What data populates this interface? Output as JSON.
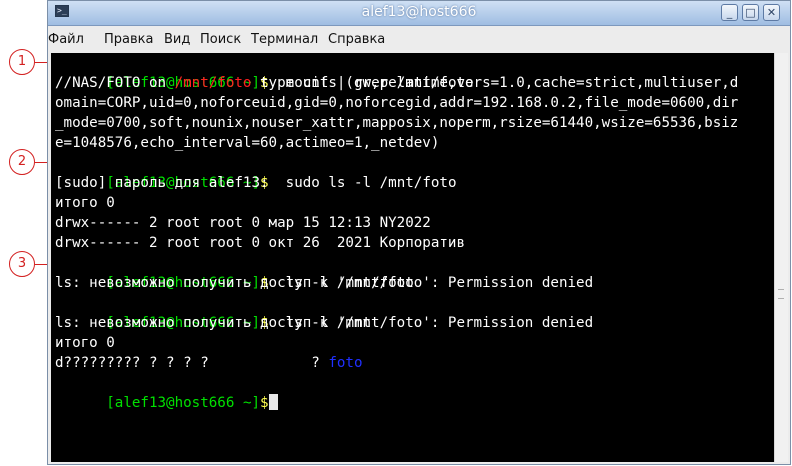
{
  "window": {
    "title": "alef13@host666",
    "controls": {
      "minimize": "_",
      "maximize": "□",
      "close": "✕"
    },
    "app_icon": ">_"
  },
  "menu": [
    "Файл",
    "Правка",
    "Вид",
    "Поиск",
    "Терминал",
    "Справка"
  ],
  "callouts": [
    "1",
    "2",
    "3"
  ],
  "terminal": {
    "prompt": {
      "user_host": "alef13@host666",
      "cwd": "~",
      "symbol": "$"
    },
    "cmd1": "mount | grep /mnt/foto",
    "mount_out1_a": "//NAS/FOTO on ",
    "mount_out1_path": "/mnt/foto",
    "mount_out1_b": " type cifs (rw,relatime,vers=1.0,cache=strict,multiuser,d",
    "mount_out2": "omain=CORP,uid=0,noforceuid,gid=0,noforcegid,addr=192.168.0.2,file_mode=0600,dir",
    "mount_out3": "_mode=0700,soft,nounix,nouser_xattr,mapposix,noperm,rsize=61440,wsize=65536,bsiz",
    "mount_out4": "e=1048576,echo_interval=60,actimeo=1,_netdev)",
    "cmd2": "sudo ls -l /mnt/foto",
    "sudo_prompt": "[sudo] пароль для alef13:",
    "total1": "итого 0",
    "dir1": "drwx------ 2 root root 0 мар 15 12:13 NY2022",
    "dir2": "drwx------ 2 root root 0 окт 26  2021 Корпоратив",
    "cmd3": "ls -l /mnt/foto",
    "err1": "ls: невозможно получить доступ к '/mnt/foto': Permission denied",
    "cmd4": "ls -l /mnt",
    "err2": "ls: невозможно получить доступ к '/mnt/foto': Permission denied",
    "total2": "итого 0",
    "unknown_entry": "d????????? ? ? ? ?            ? ",
    "foto_name": "foto"
  }
}
